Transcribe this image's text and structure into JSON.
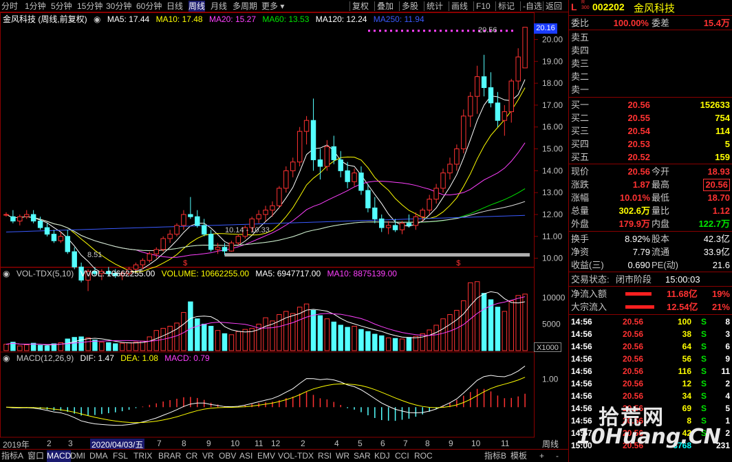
{
  "toolbar": {
    "items": [
      "分时",
      "1分钟",
      "5分钟",
      "15分钟",
      "30分钟",
      "60分钟",
      "日线",
      "周线",
      "月线",
      "多周期",
      "更多 ▾"
    ],
    "right_items": [
      "复权",
      "叠加",
      "多股",
      "统计",
      "画线",
      "F10",
      "标记",
      "-自选",
      "返回"
    ],
    "active": "周线"
  },
  "main_legend": {
    "name": "金风科技 (周线,前复权)",
    "ma5": "MA5: 17.44",
    "ma10": "MA10: 17.48",
    "ma20": "MA20: 15.27",
    "ma60": "MA60: 13.53",
    "ma120": "MA120: 12.24",
    "ma250": "MA250: 11.94"
  },
  "vol_legend": {
    "name": "VOL-TDX(5,10)",
    "vvol": "VVOL: 10662255.00",
    "volume": "VOLUME: 10662255.00",
    "ma5": "MA5: 6947717.00",
    "ma10": "MA10: 8875139.00"
  },
  "macd_legend": {
    "name": "MACD(12,26,9)",
    "dif": "DIF: 1.47",
    "dea": "DEA: 1.08",
    "macd": "MACD: 0.79"
  },
  "annotations": {
    "high": "20.56",
    "low": "8.51",
    "range": "10.14 - 10.33",
    "current_price_tag": "20.16"
  },
  "price_axis": [
    "20.00",
    "19.00",
    "18.00",
    "17.00",
    "16.00",
    "15.00",
    "14.00",
    "13.00",
    "12.00",
    "11.00",
    "10.00"
  ],
  "vol_axis": [
    "10000",
    "5000"
  ],
  "vol_unit": "X1000",
  "macd_axis": [
    "1.00"
  ],
  "date_axis": [
    "2019年",
    "2",
    "3",
    "2020/04/03/五",
    "7",
    "8",
    "9",
    "10",
    "11",
    "12",
    "2",
    "4",
    "5",
    "6",
    "7",
    "8",
    "9",
    "10",
    "11"
  ],
  "period_label": "周线",
  "bottom_tabs": [
    "指标A",
    "窗口",
    "MACD",
    "DMI",
    "DMA",
    "FSL",
    "TRIX",
    "BRAR",
    "CR",
    "VR",
    "OBV",
    "ASI",
    "EMV",
    "VOL-TDX",
    "RSI",
    "WR",
    "SAR",
    "KDJ",
    "CCI",
    "ROC"
  ],
  "bottom_right": [
    "指标B",
    "模板"
  ],
  "bottom_controls": [
    "+",
    "-"
  ],
  "quote": {
    "market_tag": "L",
    "market_sub": "R\n300",
    "code": "002202",
    "name": "金风科技",
    "weibi_label": "委比",
    "weibi": "100.00%",
    "weicha_label": "委差",
    "weicha": "15.4万",
    "sell": [
      {
        "label": "卖五",
        "price": "",
        "vol": ""
      },
      {
        "label": "卖四",
        "price": "",
        "vol": ""
      },
      {
        "label": "卖三",
        "price": "",
        "vol": ""
      },
      {
        "label": "卖二",
        "price": "",
        "vol": ""
      },
      {
        "label": "卖一",
        "price": "",
        "vol": ""
      }
    ],
    "buy": [
      {
        "label": "买一",
        "price": "20.56",
        "vol": "152633"
      },
      {
        "label": "买二",
        "price": "20.55",
        "vol": "754"
      },
      {
        "label": "买三",
        "price": "20.54",
        "vol": "114"
      },
      {
        "label": "买四",
        "price": "20.53",
        "vol": "5"
      },
      {
        "label": "买五",
        "price": "20.52",
        "vol": "159"
      }
    ],
    "stats": [
      {
        "l1": "现价",
        "v1": "20.56",
        "l2": "今开",
        "v2": "18.93"
      },
      {
        "l1": "涨跌",
        "v1": "1.87",
        "l2": "最高",
        "v2": "20.56"
      },
      {
        "l1": "涨幅",
        "v1": "10.01%",
        "l2": "最低",
        "v2": "18.70"
      },
      {
        "l1": "总量",
        "v1": "302.6万",
        "l2": "量比",
        "v2": "1.12"
      },
      {
        "l1": "外盘",
        "v1": "179.9万",
        "l2": "内盘",
        "v2": "122.7万"
      }
    ],
    "fund": [
      {
        "l1": "换手",
        "v1": "8.92%",
        "l2": "股本",
        "v2": "42.3亿"
      },
      {
        "l1": "净资",
        "v1": "7.79",
        "l2": "流通",
        "v2": "33.9亿"
      },
      {
        "l1": "收益(三)",
        "v1": "0.690",
        "l2": "PE(动)",
        "v2": "21.6"
      }
    ],
    "trade_status_label": "交易状态:",
    "trade_status": "闭市阶段",
    "trade_time": "15:00:03",
    "netflow_label": "净流入额",
    "netflow": "11.68亿",
    "netflow_pct": "19%",
    "bigflow_label": "大宗流入",
    "bigflow": "12.54亿",
    "bigflow_pct": "21%",
    "ticks": [
      {
        "t": "14:56",
        "p": "20.56",
        "v": "100",
        "d": "S",
        "n": "8"
      },
      {
        "t": "14:56",
        "p": "20.56",
        "v": "38",
        "d": "S",
        "n": "3"
      },
      {
        "t": "14:56",
        "p": "20.56",
        "v": "64",
        "d": "S",
        "n": "6"
      },
      {
        "t": "14:56",
        "p": "20.56",
        "v": "56",
        "d": "S",
        "n": "9"
      },
      {
        "t": "14:56",
        "p": "20.56",
        "v": "116",
        "d": "S",
        "n": "11"
      },
      {
        "t": "14:56",
        "p": "20.56",
        "v": "12",
        "d": "S",
        "n": "2"
      },
      {
        "t": "14:56",
        "p": "20.56",
        "v": "34",
        "d": "S",
        "n": "4"
      },
      {
        "t": "14:56",
        "p": "20.56",
        "v": "69",
        "d": "S",
        "n": "5"
      },
      {
        "t": "14:56",
        "p": "20.56",
        "v": "8",
        "d": "S",
        "n": "1"
      },
      {
        "t": "14:57",
        "p": "20.56",
        "v": "42",
        "d": "S",
        "n": "2"
      },
      {
        "t": "15:00",
        "p": "20.56",
        "v": "3768",
        "d": "",
        "n": "231"
      }
    ]
  },
  "watermark": {
    "line1": "拾荒网",
    "line2": "10Huang.CN"
  },
  "chart_data": {
    "type": "candlestick",
    "title": "金风科技 (周线,前复权)",
    "price_ylim": [
      9.8,
      20.8
    ],
    "candles": [
      [
        12.0,
        12.1,
        11.9,
        12.0
      ],
      [
        11.9,
        12.2,
        11.6,
        11.7
      ],
      [
        11.7,
        12.0,
        11.5,
        11.9
      ],
      [
        11.9,
        12.2,
        11.8,
        12.0
      ],
      [
        12.0,
        12.2,
        11.6,
        11.7
      ],
      [
        11.7,
        11.9,
        11.3,
        11.4
      ],
      [
        11.4,
        11.6,
        11.0,
        11.1
      ],
      [
        11.1,
        11.3,
        10.7,
        10.8
      ],
      [
        10.8,
        11.2,
        10.7,
        11.0
      ],
      [
        11.0,
        11.3,
        10.2,
        10.3
      ],
      [
        10.3,
        10.5,
        9.5,
        9.6
      ],
      [
        9.6,
        9.8,
        8.9,
        9.0
      ],
      [
        9.0,
        9.5,
        8.5,
        9.4
      ],
      [
        9.4,
        9.6,
        9.2,
        9.3
      ],
      [
        9.3,
        9.5,
        9.0,
        9.4
      ],
      [
        9.4,
        9.6,
        9.2,
        9.3
      ],
      [
        9.3,
        9.5,
        9.1,
        9.2
      ],
      [
        9.2,
        9.4,
        9.0,
        9.3
      ],
      [
        9.3,
        9.6,
        9.2,
        9.5
      ],
      [
        9.5,
        9.8,
        9.4,
        9.7
      ],
      [
        9.7,
        10.0,
        9.5,
        9.9
      ],
      [
        9.9,
        10.3,
        9.8,
        10.2
      ],
      [
        10.2,
        10.5,
        10.0,
        10.4
      ],
      [
        10.4,
        11.0,
        10.3,
        10.9
      ],
      [
        10.9,
        11.3,
        10.7,
        11.1
      ],
      [
        11.1,
        11.6,
        11.0,
        11.5
      ],
      [
        11.5,
        12.2,
        11.3,
        12.0
      ],
      [
        12.0,
        12.8,
        11.8,
        11.9
      ],
      [
        11.9,
        12.2,
        11.4,
        11.5
      ],
      [
        11.5,
        11.8,
        11.0,
        11.1
      ],
      [
        11.1,
        11.3,
        10.3,
        10.4
      ],
      [
        10.4,
        10.7,
        10.2,
        10.5
      ],
      [
        10.5,
        10.7,
        10.14,
        10.33
      ],
      [
        10.33,
        10.8,
        10.3,
        10.7
      ],
      [
        10.7,
        11.1,
        10.6,
        11.0
      ],
      [
        11.0,
        11.5,
        10.9,
        11.4
      ],
      [
        11.4,
        11.9,
        11.2,
        11.8
      ],
      [
        11.8,
        12.2,
        11.6,
        12.0
      ],
      [
        12.0,
        12.4,
        11.7,
        12.2
      ],
      [
        12.2,
        12.6,
        11.9,
        12.4
      ],
      [
        12.4,
        13.3,
        12.3,
        13.2
      ],
      [
        13.2,
        14.2,
        13.0,
        14.0
      ],
      [
        14.0,
        14.6,
        13.7,
        14.4
      ],
      [
        14.4,
        16.0,
        14.2,
        15.8
      ],
      [
        15.8,
        16.5,
        15.2,
        16.3
      ],
      [
        16.3,
        17.3,
        14.0,
        14.5
      ],
      [
        14.5,
        15.0,
        13.6,
        14.2
      ],
      [
        14.2,
        15.4,
        14.0,
        15.1
      ],
      [
        15.1,
        15.6,
        14.3,
        14.5
      ],
      [
        14.5,
        14.9,
        13.7,
        14.0
      ],
      [
        14.0,
        14.4,
        13.2,
        13.5
      ],
      [
        13.5,
        14.1,
        13.3,
        13.9
      ],
      [
        13.9,
        14.2,
        12.9,
        13.1
      ],
      [
        13.1,
        13.4,
        12.1,
        12.3
      ],
      [
        12.3,
        12.8,
        11.6,
        11.8
      ],
      [
        11.8,
        12.0,
        11.2,
        11.4
      ],
      [
        11.4,
        11.7,
        11.1,
        11.5
      ],
      [
        11.5,
        11.8,
        11.2,
        11.3
      ],
      [
        11.3,
        11.7,
        11.1,
        11.6
      ],
      [
        11.6,
        12.0,
        11.4,
        11.5
      ],
      [
        11.5,
        12.1,
        11.3,
        11.9
      ],
      [
        11.9,
        12.3,
        11.7,
        12.2
      ],
      [
        12.2,
        12.9,
        12.0,
        12.7
      ],
      [
        12.7,
        13.4,
        12.5,
        13.2
      ],
      [
        13.2,
        14.1,
        13.0,
        13.9
      ],
      [
        13.9,
        14.6,
        13.6,
        14.3
      ],
      [
        14.3,
        15.2,
        14.0,
        15.0
      ],
      [
        15.0,
        16.8,
        14.8,
        16.5
      ],
      [
        16.5,
        17.6,
        16.0,
        17.4
      ],
      [
        17.4,
        18.8,
        16.6,
        18.3
      ],
      [
        18.3,
        19.3,
        17.4,
        17.8
      ],
      [
        17.8,
        18.5,
        16.9,
        17.1
      ],
      [
        17.1,
        17.6,
        16.0,
        16.3
      ],
      [
        16.3,
        17.0,
        15.6,
        16.7
      ],
      [
        16.7,
        18.2,
        16.2,
        18.1
      ],
      [
        18.1,
        19.6,
        17.7,
        19.2
      ],
      [
        18.7,
        20.56,
        18.7,
        20.56
      ]
    ],
    "volume_ylim": [
      0,
      14000
    ],
    "volumes": [
      1200,
      1600,
      900,
      1100,
      1400,
      1000,
      900,
      1300,
      1500,
      2200,
      2500,
      2600,
      2400,
      2000,
      1600,
      1500,
      1300,
      1400,
      1500,
      1600,
      1800,
      2600,
      3800,
      4200,
      4600,
      5200,
      7200,
      9200,
      6000,
      5000,
      4600,
      3800,
      3200,
      3000,
      3600,
      4000,
      4200,
      5000,
      6200,
      5600,
      6800,
      7400,
      7000,
      8200,
      8800,
      7600,
      6600,
      6000,
      5400,
      4800,
      4400,
      4600,
      4000,
      3600,
      3100,
      2800,
      2400,
      2300,
      2200,
      2500,
      2700,
      3200,
      3900,
      4800,
      6000,
      6800,
      7600,
      9400,
      12800,
      13000,
      10800,
      9600,
      8200,
      7400,
      9400,
      10400,
      10662
    ],
    "macd_ylim": [
      -1.0,
      1.7
    ],
    "dif_end": 1.47,
    "dea_end": 1.08,
    "macd_end": 0.79
  }
}
